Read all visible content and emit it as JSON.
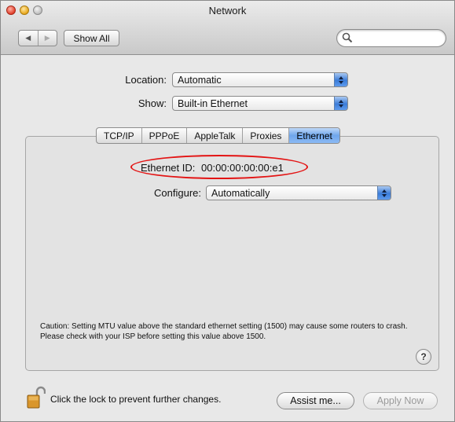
{
  "window": {
    "title": "Network"
  },
  "toolbar": {
    "back_label": "◀",
    "forward_label": "▶",
    "show_all_label": "Show All",
    "search_value": ""
  },
  "form": {
    "location_label": "Location:",
    "location_value": "Automatic",
    "show_label": "Show:",
    "show_value": "Built-in Ethernet"
  },
  "tabs": [
    {
      "label": "TCP/IP"
    },
    {
      "label": "PPPoE"
    },
    {
      "label": "AppleTalk"
    },
    {
      "label": "Proxies"
    },
    {
      "label": "Ethernet",
      "active": true
    }
  ],
  "ethernet": {
    "id_label": "Ethernet ID:",
    "id_value": "00:00:00:00:00:e1",
    "configure_label": "Configure:",
    "configure_value": "Automatically"
  },
  "caution_text": "Caution: Setting MTU value above the standard ethernet setting (1500) may cause some routers to crash.  Please check with your ISP before setting this value above 1500.",
  "help_label": "?",
  "footer": {
    "lock_text": "Click the lock to prevent further changes.",
    "assist_label": "Assist me...",
    "apply_label": "Apply Now"
  },
  "colors": {
    "highlight_ellipse": "#e31414",
    "active_tab": "#6fa6ec"
  }
}
